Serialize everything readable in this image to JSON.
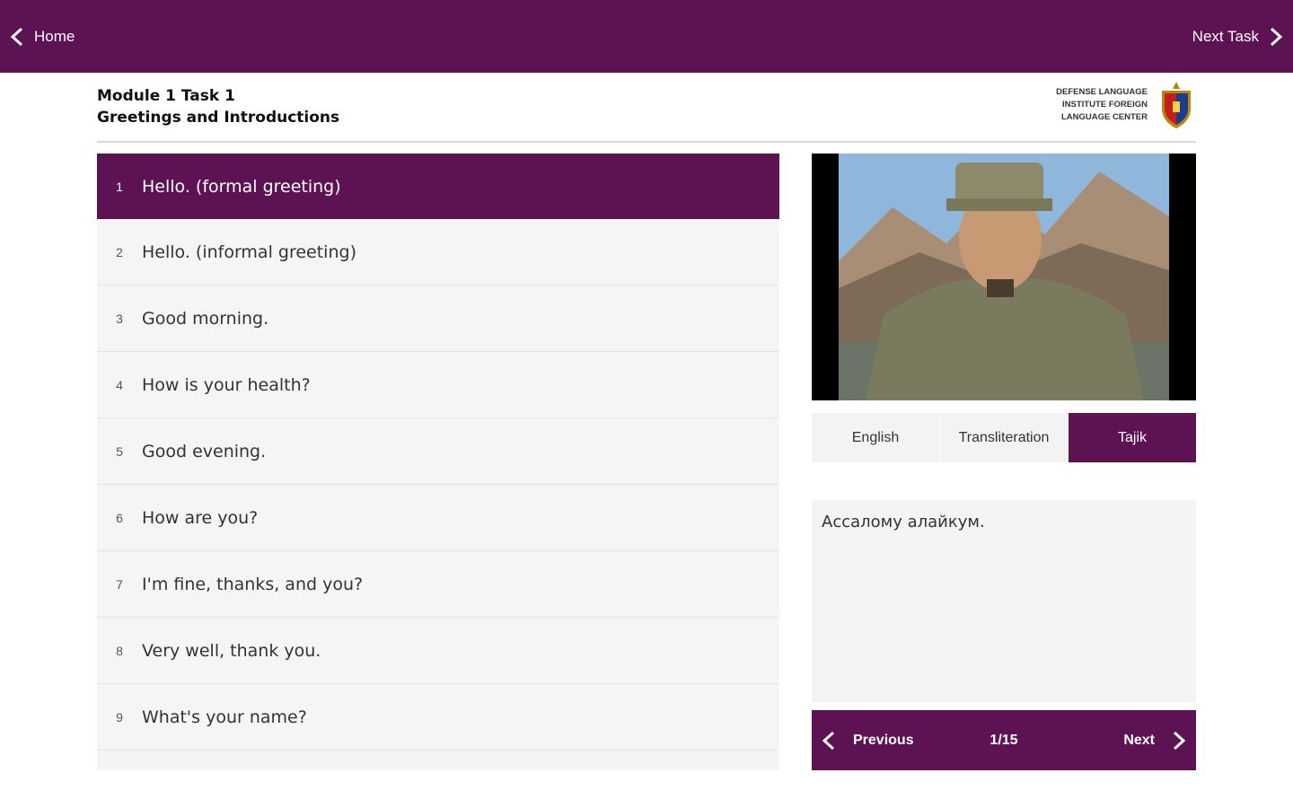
{
  "topbar": {
    "home_label": "Home",
    "next_task_label": "Next Task",
    "color": "#5d1254"
  },
  "header": {
    "module_title": "Module 1 Task 1",
    "module_subtitle": "Greetings and Introductions",
    "logo_text": [
      "DEFENSE LANGUAGE",
      "INSTITUTE FOREIGN",
      "LANGUAGE CENTER"
    ]
  },
  "phrases": [
    {
      "num": "1",
      "text": "Hello. (formal greeting)",
      "active": true
    },
    {
      "num": "2",
      "text": "Hello. (informal greeting)",
      "active": false
    },
    {
      "num": "3",
      "text": "Good morning.",
      "active": false
    },
    {
      "num": "4",
      "text": "How is your health?",
      "active": false
    },
    {
      "num": "5",
      "text": "Good evening.",
      "active": false
    },
    {
      "num": "6",
      "text": "How are you?",
      "active": false
    },
    {
      "num": "7",
      "text": "I'm fine, thanks, and you?",
      "active": false
    },
    {
      "num": "8",
      "text": "Very well, thank you.",
      "active": false
    },
    {
      "num": "9",
      "text": "What's your name?",
      "active": false
    }
  ],
  "video": {
    "icon": "soldier-video-frame"
  },
  "tabs": [
    {
      "label": "English",
      "active": false
    },
    {
      "label": "Transliteration",
      "active": false
    },
    {
      "label": "Tajik",
      "active": true
    }
  ],
  "translation_text": "Ассалому алайкум.",
  "pager": {
    "previous_label": "Previous",
    "counter": "1/15",
    "next_label": "Next"
  }
}
